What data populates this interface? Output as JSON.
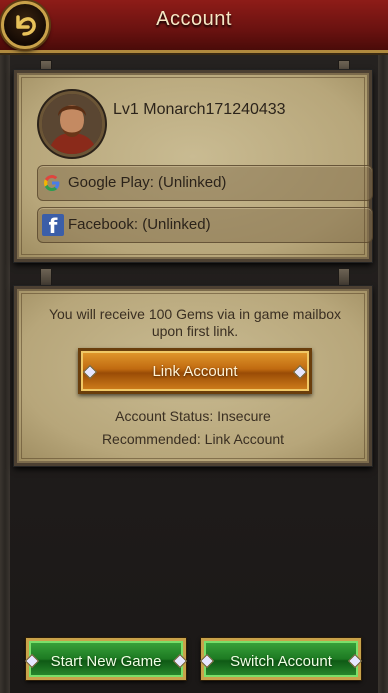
{
  "header": {
    "title": "Account",
    "back_icon": "curved-back-arrow-icon"
  },
  "profile": {
    "name": "Lv1 Monarch171240433"
  },
  "links": [
    {
      "label": "Google Play:  (Unlinked)",
      "icon": "google-icon"
    },
    {
      "label": "Facebook: (Unlinked)",
      "icon": "facebook-icon"
    }
  ],
  "reward": {
    "message_line1": "You will receive 100 Gems via in game mailbox",
    "message_line2": "upon first link.",
    "link_button": "Link Account",
    "status": "Account Status: Insecure",
    "recommended": "Recommended: Link Account"
  },
  "footer": {
    "start_new_game": "Start New Game",
    "switch_account": "Switch Account"
  },
  "colors": {
    "header_red": "#7a1612",
    "parchment": "#c4b58a",
    "gold_button": "#c06a10",
    "green_button": "#1d7a22"
  }
}
